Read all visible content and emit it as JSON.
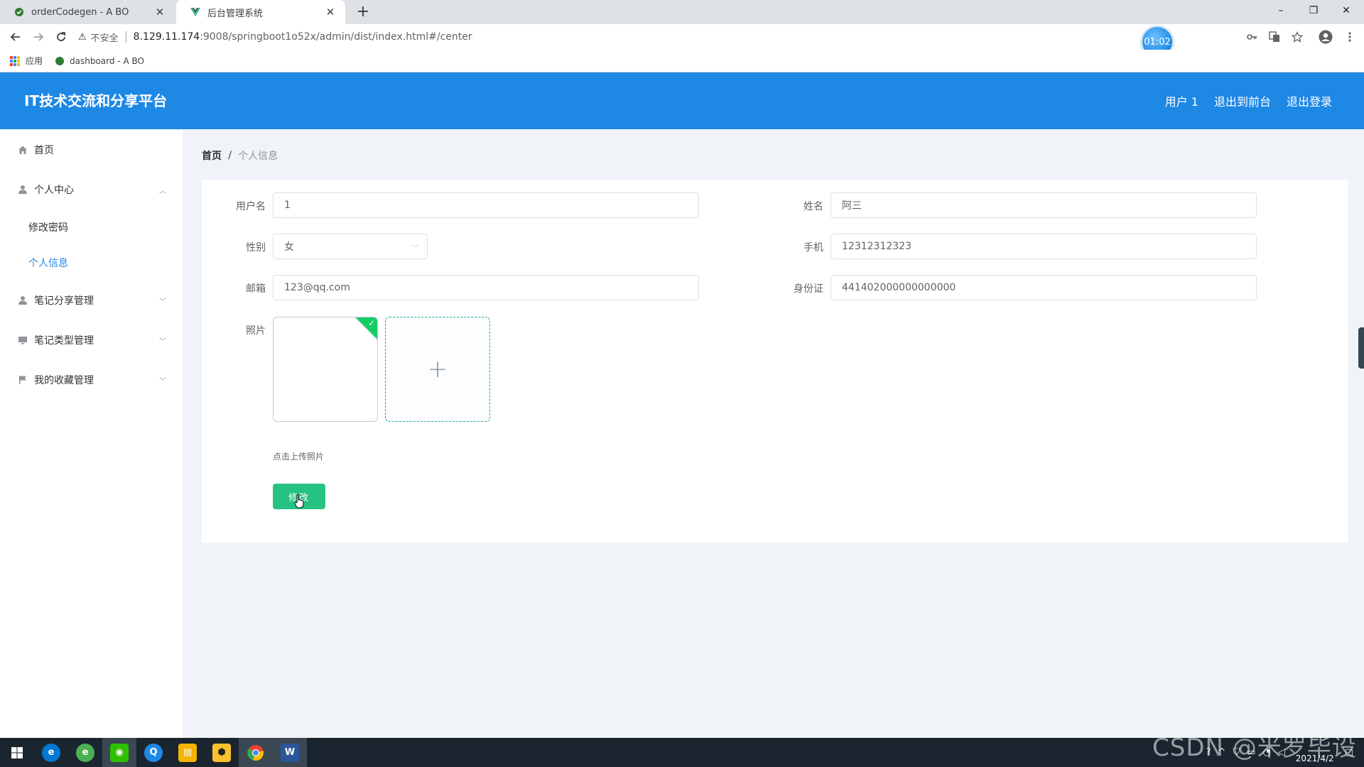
{
  "browser": {
    "tabs": [
      {
        "title": "orderCodegen - A BO",
        "close": "✕"
      },
      {
        "title": "后台管理系统",
        "close": "✕"
      }
    ],
    "new_tab": "+",
    "window_controls": {
      "minimize": "–",
      "maximize": "❐",
      "close": "✕"
    },
    "security_warning": "⚠",
    "insecure_label": "不安全",
    "url_host": "8.129.11.174",
    "url_path": ":9008/springboot1o52x/admin/dist/index.html#/center",
    "timer": "01:02",
    "bookmarks": [
      {
        "label": "应用"
      },
      {
        "label": "dashboard - A BO"
      }
    ]
  },
  "header": {
    "brand": "IT技术交流和分享平台",
    "user": "用户 1",
    "to_front": "退出到前台",
    "logout": "退出登录"
  },
  "sidebar": {
    "items": [
      {
        "label": "首页",
        "icon": "home-icon"
      },
      {
        "label": "个人中心",
        "icon": "user-icon",
        "expanded": true,
        "children": [
          {
            "label": "修改密码"
          },
          {
            "label": "个人信息",
            "active": true
          }
        ]
      },
      {
        "label": "笔记分享管理",
        "icon": "user-icon"
      },
      {
        "label": "笔记类型管理",
        "icon": "monitor-icon"
      },
      {
        "label": "我的收藏管理",
        "icon": "flag-icon"
      }
    ]
  },
  "breadcrumb": {
    "home": "首页",
    "separator": "/",
    "current": "个人信息"
  },
  "form": {
    "username": {
      "label": "用户名",
      "value": "1"
    },
    "name": {
      "label": "姓名",
      "value": "阿三"
    },
    "gender": {
      "label": "性别",
      "value": "女"
    },
    "phone": {
      "label": "手机",
      "value": "12312312323"
    },
    "email": {
      "label": "邮箱",
      "value": "123@qq.com"
    },
    "id_card": {
      "label": "身份证",
      "value": "441402000000000000"
    },
    "photo": {
      "label": "照片",
      "upload_plus": "+",
      "tip": "点击上传照片"
    },
    "submit": "修改"
  },
  "taskbar": {
    "clock_date": "2021/4/2",
    "watermark": "CSDN @米罗毕设"
  },
  "colors": {
    "header": "#1e88e5",
    "active_menu": "#1e88e5",
    "submit_button": "#26c281",
    "upload_border": "#26a69a",
    "success_badge": "#13ce66"
  }
}
